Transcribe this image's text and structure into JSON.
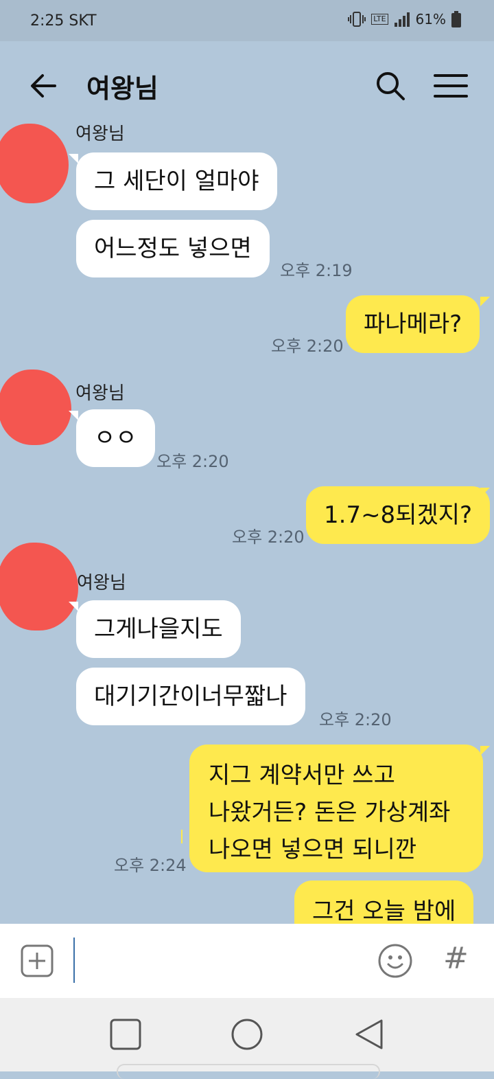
{
  "status_bar": {
    "time_carrier": "2:25 SKT",
    "lte_label": "LTE",
    "battery": "61%"
  },
  "app_bar": {
    "title": "여왕님"
  },
  "messages": [
    {
      "side": "left",
      "sender": "여왕님",
      "bubbles": [
        "그 세단이 얼마야",
        "어느정도 넣으면"
      ],
      "time": "오후 2:19"
    },
    {
      "side": "right",
      "bubbles": [
        "파나메라?"
      ],
      "time": "오후 2:20"
    },
    {
      "side": "left",
      "sender": "여왕님",
      "bubbles": [
        "ㅇㅇ"
      ],
      "time": "오후 2:20"
    },
    {
      "side": "right",
      "bubbles": [
        "1.7~8되겠지?"
      ],
      "time": "오후 2:20"
    },
    {
      "side": "left",
      "sender": "여왕님",
      "bubbles": [
        "그게나을지도",
        "대기기간이너무짧나"
      ],
      "time": "오후 2:20"
    },
    {
      "side": "right",
      "bubbles": [
        "지그 계약서만 쓰고\n나왔거든? 돈은 가상계좌\n나오면 넣으면 되니깐",
        "그건 오늘 밤에"
      ],
      "time": "오후 2:24"
    }
  ],
  "input_bar": {
    "value": "",
    "placeholder": "",
    "hash_symbol": "#"
  },
  "colors": {
    "background": "#b2c7da",
    "my_bubble": "#fee94e",
    "other_bubble": "#ffffff"
  }
}
